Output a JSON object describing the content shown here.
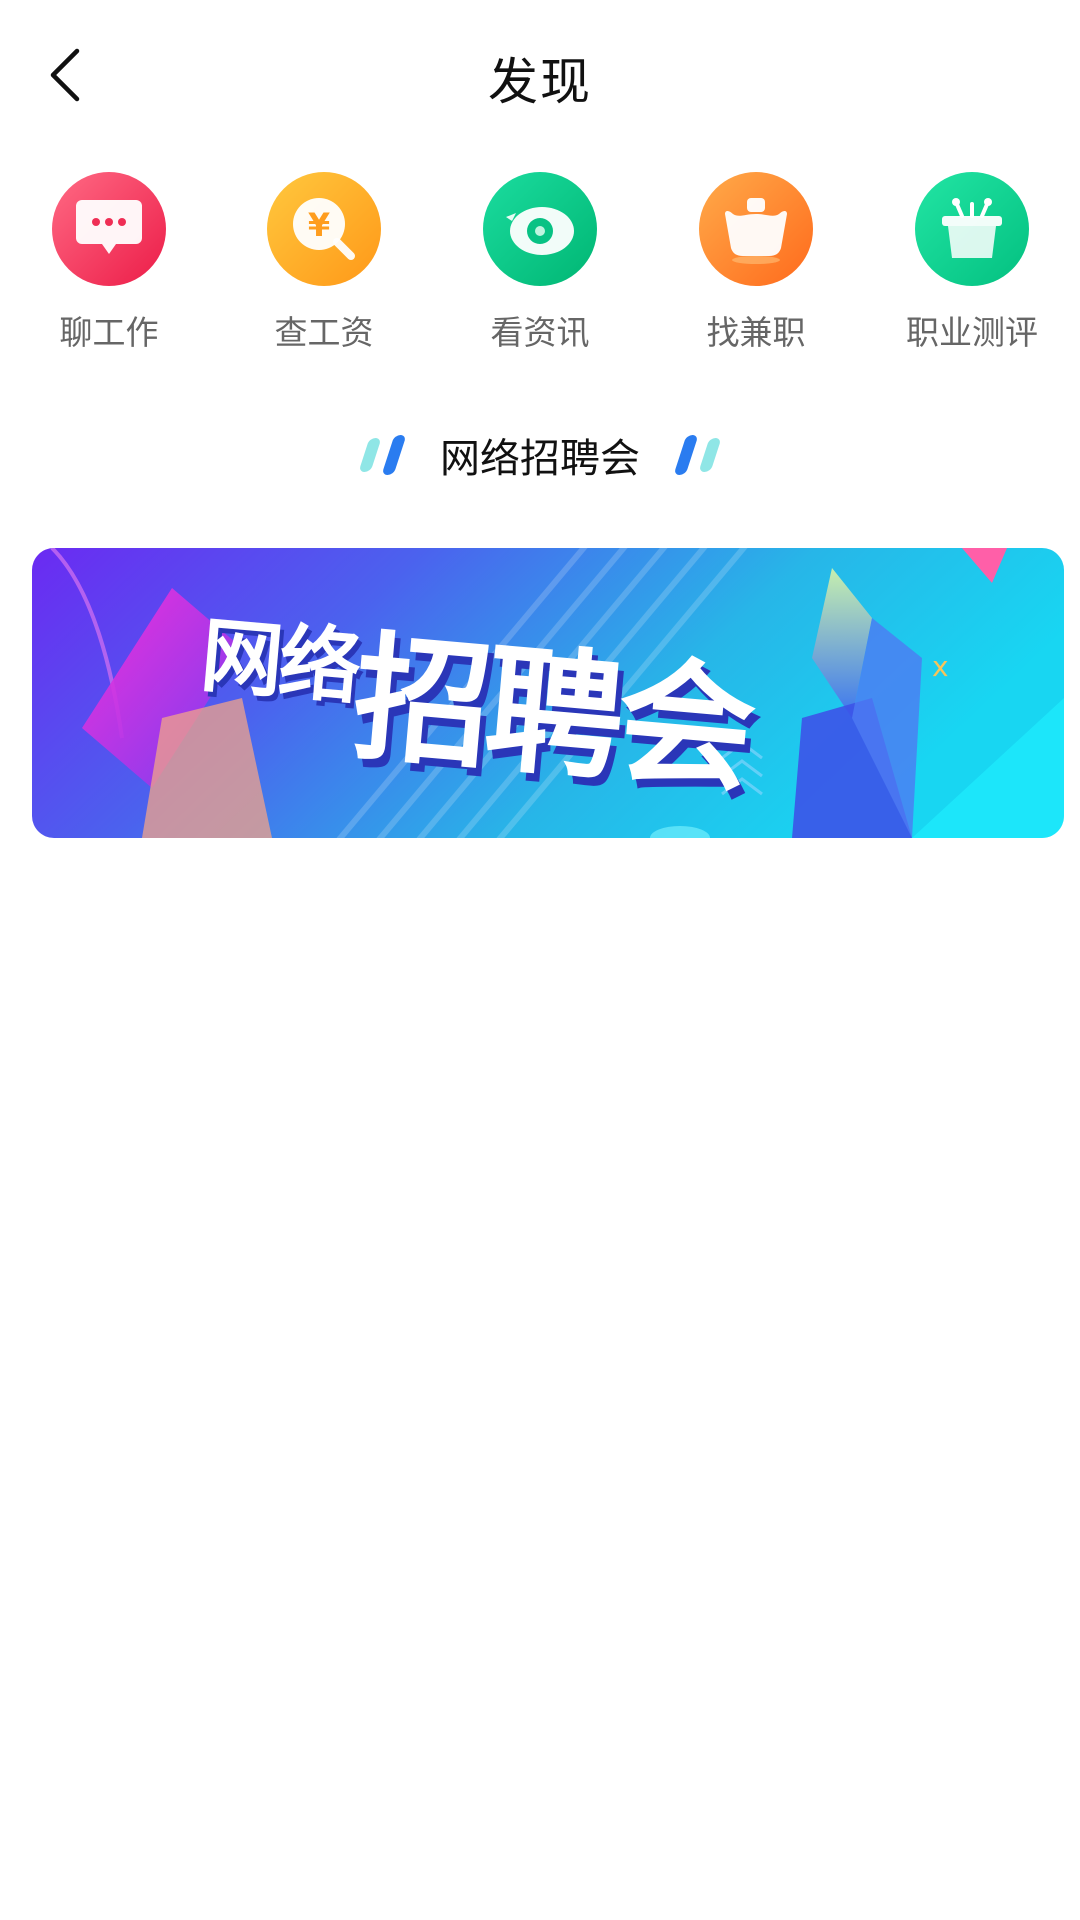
{
  "header": {
    "title": "发现",
    "back_icon": "chevron-left-icon"
  },
  "features": [
    {
      "label": "聊工作",
      "icon": "chat-bubble-icon",
      "color_from": "#ff5b78",
      "color_to": "#ef1f4a"
    },
    {
      "label": "查工资",
      "icon": "yuan-search-icon",
      "color_from": "#ffc23a",
      "color_to": "#ff9a1a"
    },
    {
      "label": "看资讯",
      "icon": "eye-icon",
      "color_from": "#17d79a",
      "color_to": "#00b877"
    },
    {
      "label": "找兼职",
      "icon": "basket-icon",
      "color_from": "#ffa646",
      "color_to": "#ff6d1f"
    },
    {
      "label": "职业测评",
      "icon": "podium-icon",
      "color_from": "#1ee3a0",
      "color_to": "#06c282"
    }
  ],
  "section": {
    "title": "网络招聘会",
    "accent_light": "#8fe6e6",
    "accent_dark": "#2a7cf0"
  },
  "banner": {
    "text_small": "网络",
    "text_big": "招聘会"
  }
}
